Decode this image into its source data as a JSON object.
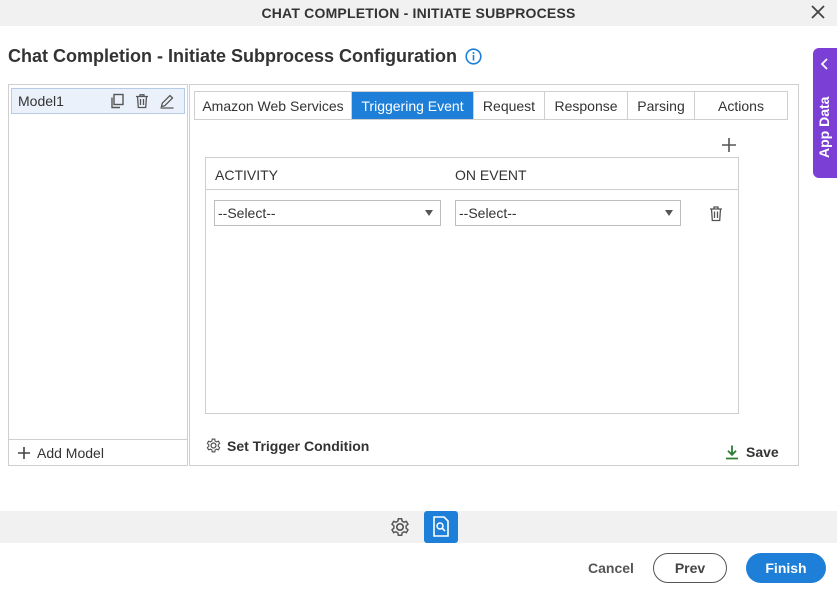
{
  "window": {
    "title": "CHAT COMPLETION - INITIATE SUBPROCESS"
  },
  "page": {
    "heading": "Chat Completion - Initiate Subprocess Configuration"
  },
  "app_data": {
    "label": "App Data"
  },
  "models": {
    "items": [
      {
        "name": "Model1"
      }
    ],
    "add_label": "Add Model"
  },
  "tabs": [
    {
      "label": "Amazon Web Services",
      "active": false
    },
    {
      "label": "Triggering Event",
      "active": true
    },
    {
      "label": "Request",
      "active": false
    },
    {
      "label": "Response",
      "active": false
    },
    {
      "label": "Parsing",
      "active": false
    },
    {
      "label": "Actions",
      "active": false
    }
  ],
  "grid": {
    "columns": [
      "ACTIVITY",
      "ON EVENT"
    ],
    "rows": [
      {
        "activity": "--Select--",
        "on_event": "--Select--"
      }
    ]
  },
  "actions": {
    "set_trigger_condition": "Set Trigger Condition",
    "save": "Save"
  },
  "footer": {
    "cancel": "Cancel",
    "prev": "Prev",
    "finish": "Finish"
  },
  "colors": {
    "accent": "#1e7fd8",
    "app_data": "#7b3fd6",
    "save_icon": "#2e7d32"
  }
}
